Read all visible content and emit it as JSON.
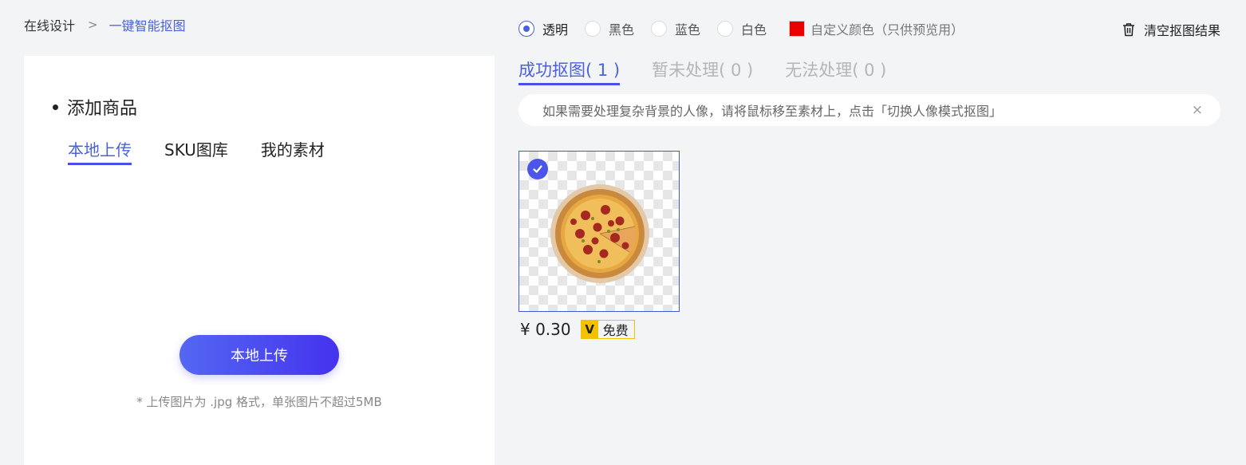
{
  "breadcrumb": {
    "home": "在线设计",
    "separator": ">",
    "current": "一键智能抠图"
  },
  "left_panel": {
    "section_title": "添加商品",
    "tabs": [
      {
        "label": "本地上传",
        "active": true
      },
      {
        "label": "SKU图库",
        "active": false
      },
      {
        "label": "我的素材",
        "active": false
      }
    ],
    "upload_button": "本地上传",
    "upload_hint": "* 上传图片为 .jpg 格式，单张图片不超过5MB"
  },
  "background_options": [
    {
      "label": "透明",
      "selected": true
    },
    {
      "label": "黑色",
      "selected": false
    },
    {
      "label": "蓝色",
      "selected": false
    },
    {
      "label": "白色",
      "selected": false
    }
  ],
  "custom_color": {
    "label": "自定义颜色（只供预览用）",
    "color": "#e80000"
  },
  "clear_button": {
    "label": "清空抠图结果",
    "icon": "trash-icon"
  },
  "result_tabs": [
    {
      "label": "成功抠图( 1 )",
      "active": true
    },
    {
      "label": "暂未处理( 0 )",
      "active": false
    },
    {
      "label": "无法处理( 0 )",
      "active": false
    }
  ],
  "notice": {
    "text": "如果需要处理复杂背景的人像，请将鼠标移至素材上，点击「切换人像模式抠图」",
    "close": "×"
  },
  "result_item": {
    "selected": true,
    "price": "¥ 0.30",
    "vip_mark": "V",
    "free_label": "免费"
  },
  "colors": {
    "accent": "#4a62d8",
    "button_gradient_start": "#5467f2",
    "button_gradient_end": "#4433ee",
    "vip_yellow": "#f2c200"
  }
}
